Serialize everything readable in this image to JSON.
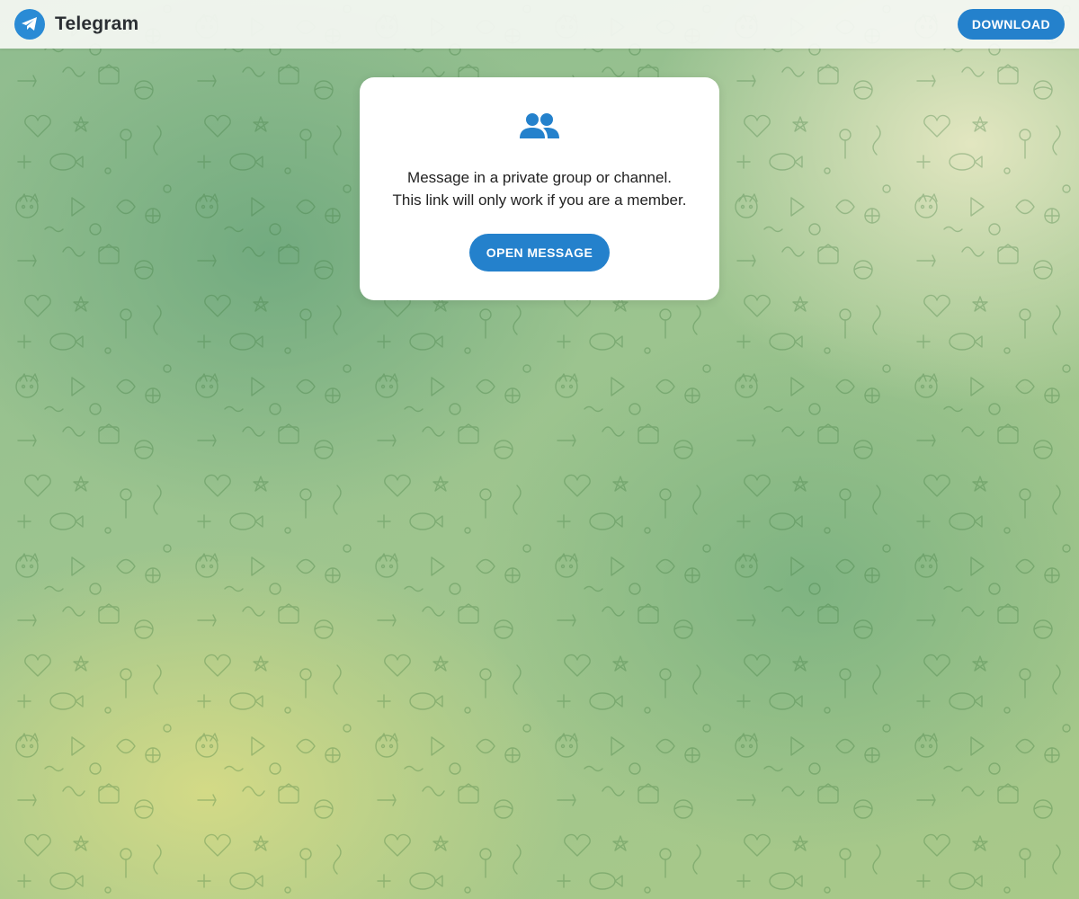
{
  "header": {
    "logo_icon": "paper-plane-icon",
    "logo_text": "Telegram",
    "download_label": "DOWNLOAD"
  },
  "card": {
    "icon": "group-icon",
    "line1": "Message in a private group or channel.",
    "line2": "This link will only work if you are a member.",
    "open_label": "OPEN MESSAGE"
  },
  "colors": {
    "accent": "#2481cc",
    "logo": "#2a8bd5",
    "text": "#222222"
  }
}
